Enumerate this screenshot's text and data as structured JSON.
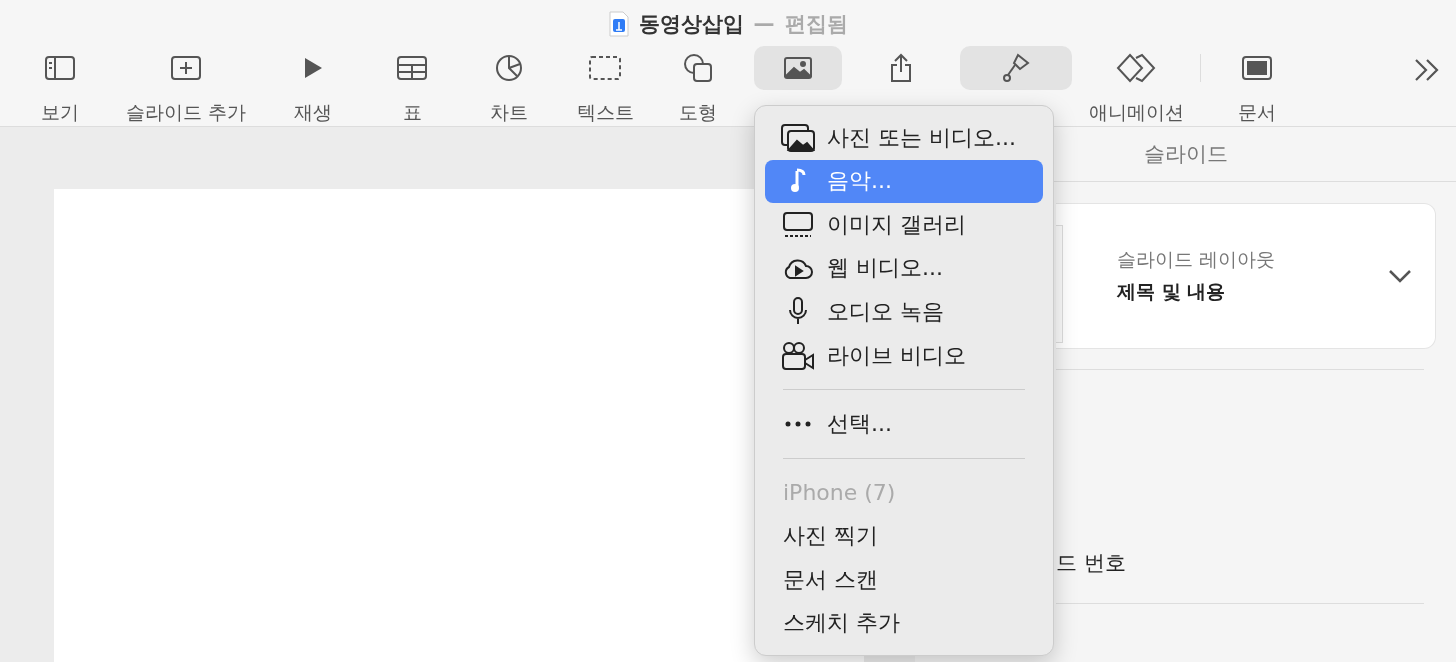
{
  "window": {
    "title": "동영상삽입",
    "separator": "—",
    "status": "편집됨"
  },
  "toolbar": [
    {
      "label": "보기",
      "selected": false
    },
    {
      "label": "슬라이드 추가",
      "selected": false
    },
    {
      "label": "재생",
      "selected": false
    },
    {
      "label": "표",
      "selected": false
    },
    {
      "label": "차트",
      "selected": false
    },
    {
      "label": "텍스트",
      "selected": false
    },
    {
      "label": "도형",
      "selected": false
    },
    {
      "selected": true
    },
    {
      "selected": false
    },
    {
      "selected": true
    },
    {
      "label": "애니메이션",
      "selected": false
    },
    {
      "label": "문서",
      "selected": false
    }
  ],
  "inspector": {
    "header": "슬라이드",
    "layout_label": "슬라이드 레이아웃",
    "layout_value": "제목 및 내용",
    "row_label": "드 번호"
  },
  "menu": {
    "sections": [
      {
        "items": [
          {
            "label": "사진 또는 비디오...",
            "selected": false
          },
          {
            "label": "음악...",
            "selected": true
          },
          {
            "label": "이미지 갤러리",
            "selected": false
          },
          {
            "label": "웹 비디오...",
            "selected": false
          },
          {
            "label": "오디오 녹음",
            "selected": false
          },
          {
            "label": "라이브 비디오",
            "selected": false
          }
        ]
      },
      {
        "items": [
          {
            "label": "선택...",
            "selected": false
          }
        ]
      },
      {
        "header": "iPhone (7)",
        "items": [
          {
            "label": "사진 찍기",
            "selected": false
          },
          {
            "label": "문서 스캔",
            "selected": false
          },
          {
            "label": "스케치 추가",
            "selected": false
          }
        ]
      }
    ]
  }
}
